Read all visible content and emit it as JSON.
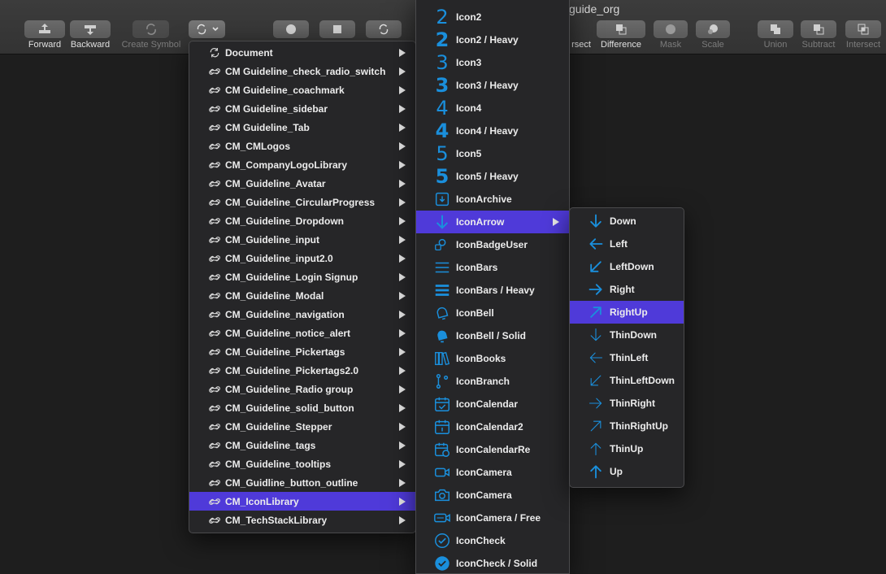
{
  "title": "guide_org",
  "toolbar": {
    "forward": "Forward",
    "backward": "Backward",
    "create_symbol": "Create Symbol",
    "intersect_partial": "rsect",
    "difference": "Difference",
    "mask": "Mask",
    "scale": "Scale",
    "union": "Union",
    "subtract": "Subtract",
    "intersect": "Intersect"
  },
  "menu1": {
    "items": [
      {
        "label": "Document"
      },
      {
        "label": "CM Guideline_check_radio_switch"
      },
      {
        "label": "CM Guideline_coachmark"
      },
      {
        "label": "CM Guideline_sidebar"
      },
      {
        "label": "CM Guideline_Tab"
      },
      {
        "label": "CM_CMLogos"
      },
      {
        "label": "CM_CompanyLogoLibrary"
      },
      {
        "label": "CM_Guideline_Avatar"
      },
      {
        "label": "CM_Guideline_CircularProgress"
      },
      {
        "label": "CM_Guideline_Dropdown"
      },
      {
        "label": "CM_Guideline_input"
      },
      {
        "label": "CM_Guideline_input2.0"
      },
      {
        "label": "CM_Guideline_Login Signup"
      },
      {
        "label": "CM_Guideline_Modal"
      },
      {
        "label": "CM_Guideline_navigation"
      },
      {
        "label": "CM_Guideline_notice_alert"
      },
      {
        "label": "CM_Guideline_Pickertags"
      },
      {
        "label": "CM_Guideline_Pickertags2.0"
      },
      {
        "label": "CM_Guideline_Radio group"
      },
      {
        "label": "CM_Guideline_solid_button"
      },
      {
        "label": "CM_Guideline_Stepper"
      },
      {
        "label": "CM_Guideline_tags"
      },
      {
        "label": "CM_Guideline_tooltips"
      },
      {
        "label": "CM_Guidline_button_outline"
      },
      {
        "label": "CM_IconLibrary"
      },
      {
        "label": "CM_TechStackLibrary"
      }
    ],
    "highlighted": "CM_IconLibrary"
  },
  "menu2": {
    "items": [
      {
        "label": "Icon2",
        "glyph": "2",
        "icon": "number-2-icon"
      },
      {
        "label": "Icon2 / Heavy",
        "glyph": "2",
        "icon": "number-2-heavy-icon"
      },
      {
        "label": "Icon3",
        "glyph": "3",
        "icon": "number-3-icon"
      },
      {
        "label": "Icon3 / Heavy",
        "glyph": "3",
        "icon": "number-3-heavy-icon"
      },
      {
        "label": "Icon4",
        "glyph": "4",
        "icon": "number-4-icon"
      },
      {
        "label": "Icon4 / Heavy",
        "glyph": "4",
        "icon": "number-4-heavy-icon"
      },
      {
        "label": "Icon5",
        "glyph": "5",
        "icon": "number-5-icon"
      },
      {
        "label": "Icon5 / Heavy",
        "glyph": "5",
        "icon": "number-5-heavy-icon"
      },
      {
        "label": "IconArchive",
        "icon": "archive-icon"
      },
      {
        "label": "IconArrow",
        "icon": "arrow-down-icon"
      },
      {
        "label": "IconBadgeUser",
        "icon": "badge-user-icon"
      },
      {
        "label": "IconBars",
        "icon": "bars-icon"
      },
      {
        "label": "IconBars / Heavy",
        "icon": "bars-heavy-icon"
      },
      {
        "label": "IconBell",
        "icon": "bell-icon"
      },
      {
        "label": "IconBell / Solid",
        "icon": "bell-solid-icon"
      },
      {
        "label": "IconBooks",
        "icon": "books-icon"
      },
      {
        "label": "IconBranch",
        "icon": "branch-icon"
      },
      {
        "label": "IconCalendar",
        "icon": "calendar-icon"
      },
      {
        "label": "IconCalendar2",
        "icon": "calendar-2-icon"
      },
      {
        "label": "IconCalendarRe",
        "icon": "calendar-repeat-icon"
      },
      {
        "label": "IconCamera",
        "icon": "video-camera-icon"
      },
      {
        "label": "IconCamera",
        "icon": "camera-icon"
      },
      {
        "label": "IconCamera / Free",
        "icon": "camera-free-icon"
      },
      {
        "label": "IconCheck",
        "icon": "check-circle-icon"
      },
      {
        "label": "IconCheck / Solid",
        "icon": "check-circle-solid-icon"
      }
    ],
    "highlighted": "IconArrow"
  },
  "menu3": {
    "items": [
      {
        "label": "Down",
        "icon": "arrow-down-icon"
      },
      {
        "label": "Left",
        "icon": "arrow-left-icon"
      },
      {
        "label": "LeftDown",
        "icon": "arrow-left-down-icon"
      },
      {
        "label": "Right",
        "icon": "arrow-right-icon"
      },
      {
        "label": "RightUp",
        "icon": "arrow-right-up-icon"
      },
      {
        "label": "ThinDown",
        "icon": "thin-arrow-down-icon"
      },
      {
        "label": "ThinLeft",
        "icon": "thin-arrow-left-icon"
      },
      {
        "label": "ThinLeftDown",
        "icon": "thin-arrow-left-down-icon"
      },
      {
        "label": "ThinRight",
        "icon": "thin-arrow-right-icon"
      },
      {
        "label": "ThinRightUp",
        "icon": "thin-arrow-right-up-icon"
      },
      {
        "label": "ThinUp",
        "icon": "thin-arrow-up-icon"
      },
      {
        "label": "Up",
        "icon": "arrow-up-icon"
      }
    ],
    "highlighted": "RightUp"
  },
  "colors": {
    "accent": "#1a8fdc",
    "highlight": "#4f3ad9",
    "menu_bg": "#262628"
  }
}
